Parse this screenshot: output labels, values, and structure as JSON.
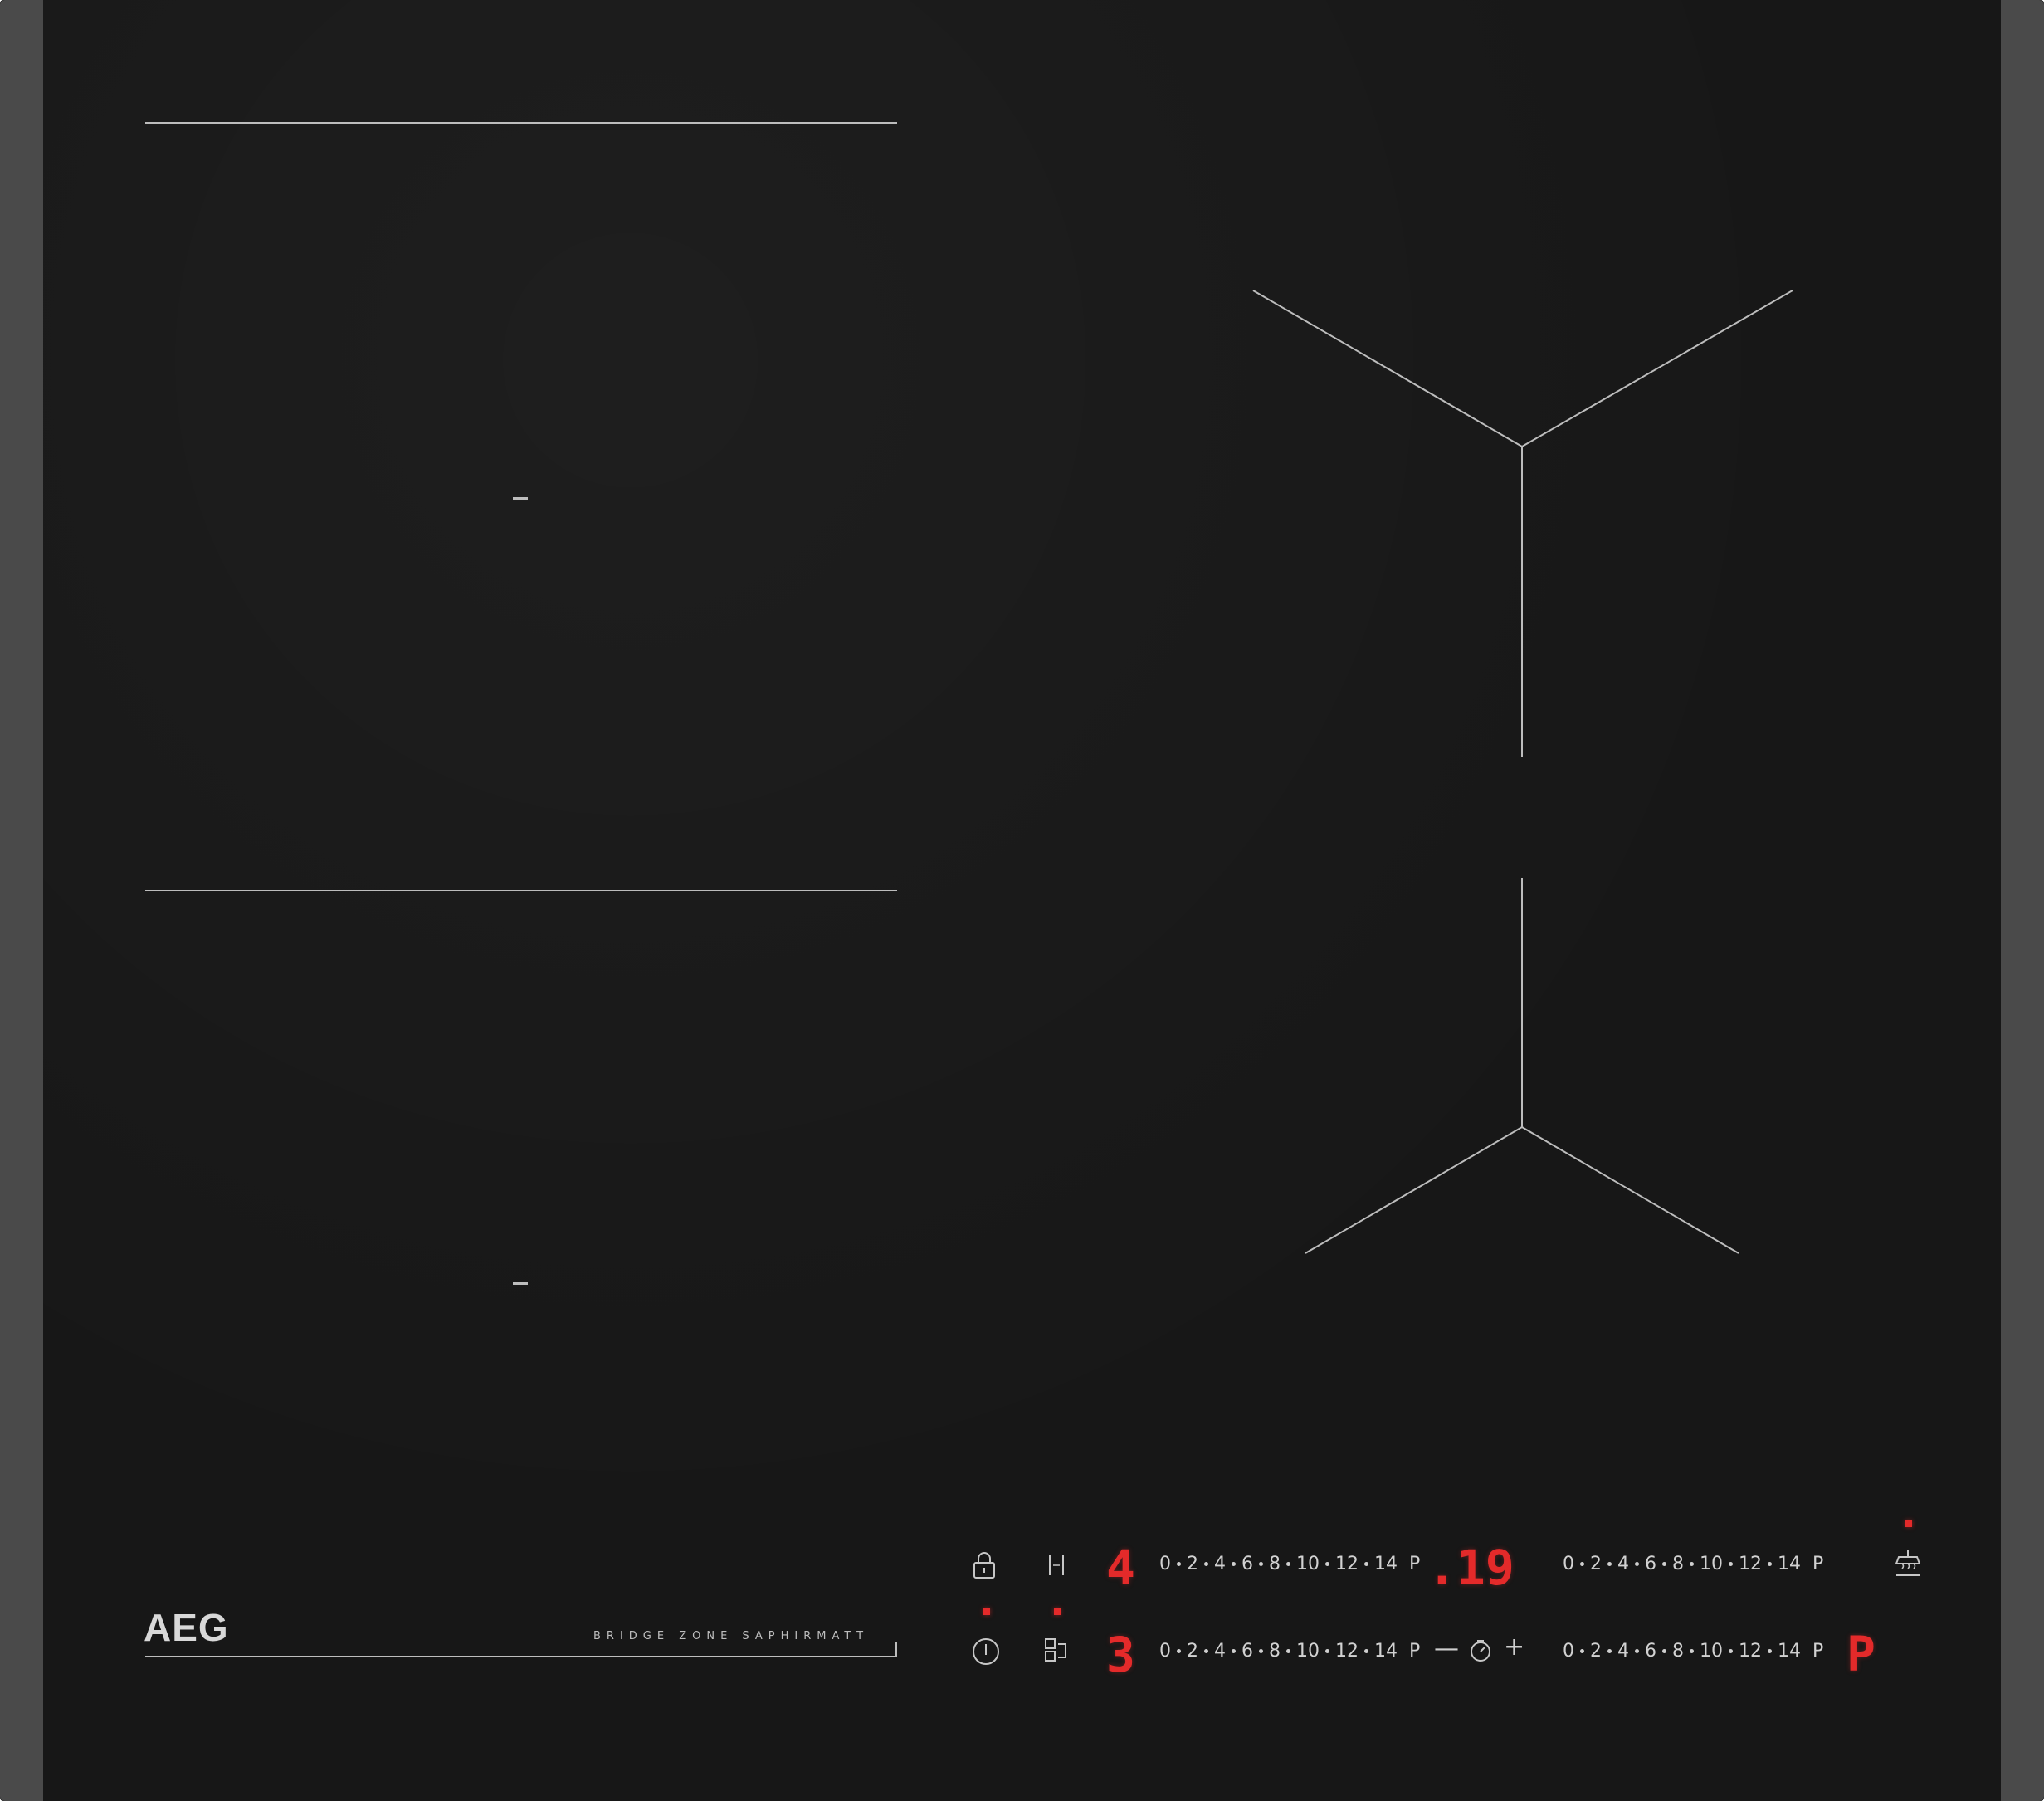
{
  "brand": {
    "logo": "AEG",
    "model_text": "BRIDGE ZONE SAPHIRMATT"
  },
  "power_scale": [
    "0",
    "2",
    "4",
    "6",
    "8",
    "10",
    "12",
    "14",
    "P"
  ],
  "displays": {
    "front_left_level": "4",
    "rear_left_level": "3",
    "timer_value": ".19",
    "right_zone_level": "P"
  },
  "timer_controls": {
    "minus": "—",
    "plus": "+"
  },
  "icons": {
    "lock": "lock-icon",
    "bridge": "bridge-icon",
    "power": "power-icon",
    "combine": "combine-zones-icon",
    "clock": "clock-icon",
    "hood": "hood-link-icon"
  },
  "colors": {
    "glass": "#171717",
    "frame": "#4a4a4a",
    "display_red": "#e42a2a",
    "printing": "#c6c6c6"
  }
}
